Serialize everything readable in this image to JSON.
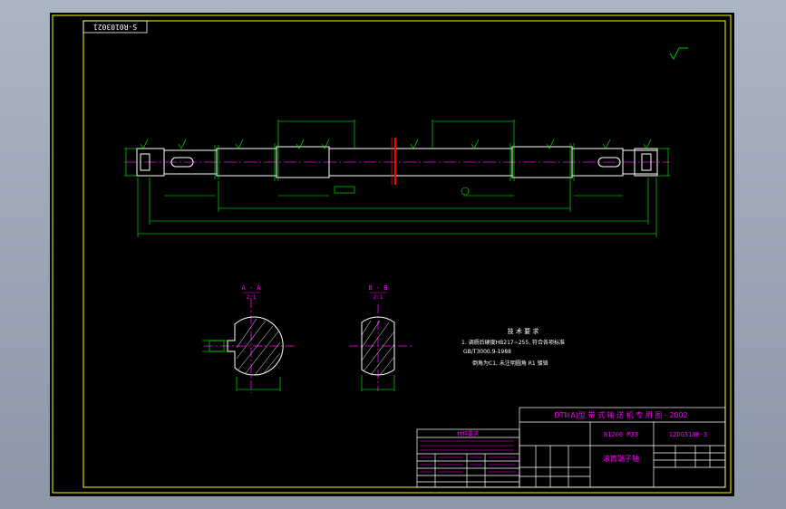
{
  "drawing": {
    "stamp": "S-R0103021",
    "colors": {
      "background": "#000000",
      "frame": "#ffff00",
      "outline": "#ffffff",
      "dimension": "#00ff00",
      "text": "#ff00ff",
      "section": "#ff0000",
      "center": "#ff00ff"
    }
  },
  "sections": {
    "view_a_label": "A - A",
    "view_a_scale": "2:1",
    "view_b_label": "B - B",
    "view_b_scale": "2:1"
  },
  "notes": {
    "title": "技 术 要 求",
    "line1": "1. 调质后硬度HB217~255, 符合各项标准",
    "line2": "GB/T3000.9-1988",
    "line3": "倒角为C1, 未注明圆角 R1 镀铬"
  },
  "title_block": {
    "header": "DTⅡ(A)型  带 式 输 送 机 专 用 图 - 2002",
    "spec_left": "B1200  M33",
    "drawing_no": "12DG3100-3",
    "part_name": "滚筒端子轴",
    "table_title": "材料要求"
  }
}
